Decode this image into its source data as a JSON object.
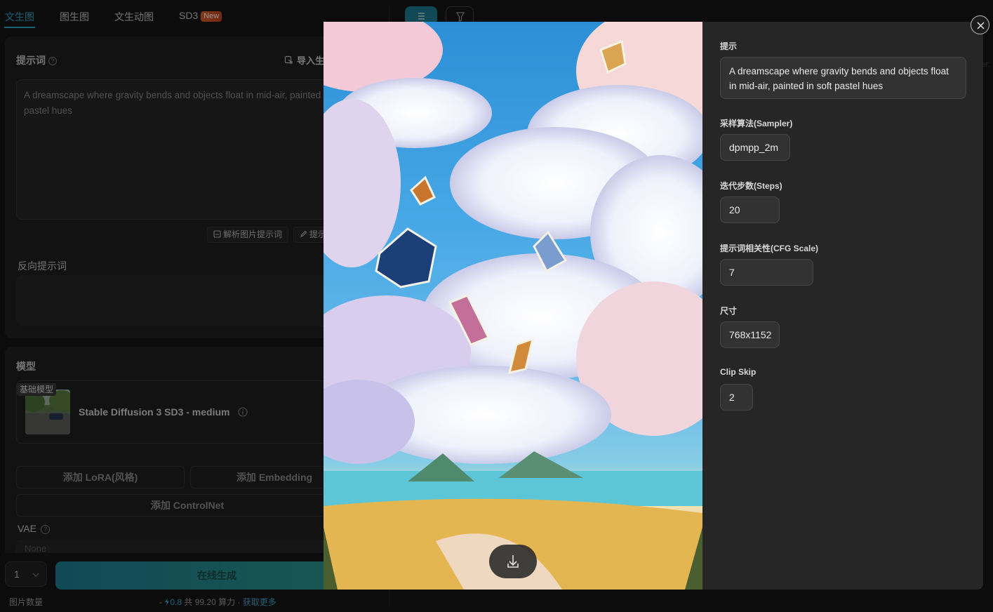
{
  "tabs": [
    {
      "label": "文生图",
      "active": true
    },
    {
      "label": "图生图",
      "active": false
    },
    {
      "label": "文生动图",
      "active": false
    },
    {
      "label": "SD3",
      "active": false,
      "badge": "New"
    }
  ],
  "prompt_section": {
    "label": "提示词",
    "import_label": "导入生",
    "text": "A dreamscape where gravity bends and objects float in mid-air, painted in soft pastel hues",
    "parse_image_button": "解析图片提示词",
    "enhance_button": "提示"
  },
  "negative_prompt": {
    "label": "反向提示词",
    "text": ""
  },
  "model_section": {
    "label": "模型",
    "tag": "基础模型",
    "name": "Stable Diffusion 3 SD3 - medium",
    "add_lora": "添加 LoRA(风格)",
    "add_embedding": "添加 Embedding",
    "add_controlnet": "添加 ControlNet",
    "vae_label": "VAE",
    "vae_placeholder": "None"
  },
  "footer": {
    "quantity_value": "1",
    "quantity_label": "图片数量",
    "generate_label": "在线生成",
    "power_cost": "0.8",
    "power_total_text": "共 99.20 算力 ·",
    "get_more": "获取更多"
  },
  "modal": {
    "prompt_label": "提示",
    "prompt_value": "A dreamscape where gravity bends and objects float in mid-air, painted in soft pastel hues",
    "sampler_label": "采样算法(Sampler)",
    "sampler_value": "dpmpp_2m",
    "steps_label": "迭代步数(Steps)",
    "steps_value": "20",
    "cfg_label": "提示词相关性(CFG Scale)",
    "cfg_value": "7",
    "size_label": "尺寸",
    "size_value": "768x1152",
    "clip_label": "Clip Skip",
    "clip_value": "2"
  },
  "icons": {
    "close": "close-icon",
    "download": "download-icon",
    "list": "list-icon",
    "filter": "filter-icon",
    "help": "help-icon",
    "import": "import-icon"
  },
  "colors": {
    "accent": "#2fa7c9",
    "badge": "#e0612d",
    "generate_from": "#1f7e96",
    "generate_to": "#2a9a8c"
  }
}
